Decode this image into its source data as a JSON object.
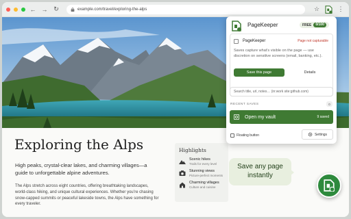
{
  "browser": {
    "url": "example.com/travel/exploring-the-alps"
  },
  "article": {
    "title": "Exploring the Alps",
    "subtitle": "High peaks, crystal-clear lakes, and charming villages—a guide to unforgettable alpine adventures.",
    "body": "The Alps stretch across eight countries, offering breathtaking landscapes, world-class hiking, and unique cultural experiences. Whether you’re chasing snow-capped summits or peaceful lakeside towns, the Alps have something for every traveler."
  },
  "highlights": {
    "title": "Highlights",
    "items": [
      {
        "name": "Scenic hikes",
        "desc": "Trails for every level",
        "icon": "mountain-icon"
      },
      {
        "name": "Stunning views",
        "desc": "Picture-perfect moments",
        "icon": "camera-icon"
      },
      {
        "name": "Charming villages",
        "desc": "Culture and cuisine",
        "icon": "house-icon"
      }
    ]
  },
  "popup": {
    "name": "PageKeeper",
    "plan": "FREE",
    "usage": "0/100",
    "card_title": "PageKeeper",
    "status": "Page not capturable",
    "description": "Saves capture what’s visible on the page — use discretion on sensitive screens (email, banking, etc.).",
    "save_label": "Save this page",
    "details_label": "Details",
    "search_placeholder": "Search title, url, notes… (in:work  site:github.com)",
    "recent_label": "RECENT SAVES",
    "recent_count": "0",
    "vault_label": "Open my vault",
    "vault_count": "9 saved",
    "floating_label": "Floating button",
    "settings_label": "Settings"
  },
  "tooltip": {
    "line1": "Save any page",
    "line2": "instantly"
  },
  "colors": {
    "accent": "#3f7a33",
    "fab": "#2e8a3d",
    "warning": "#c0392b"
  }
}
